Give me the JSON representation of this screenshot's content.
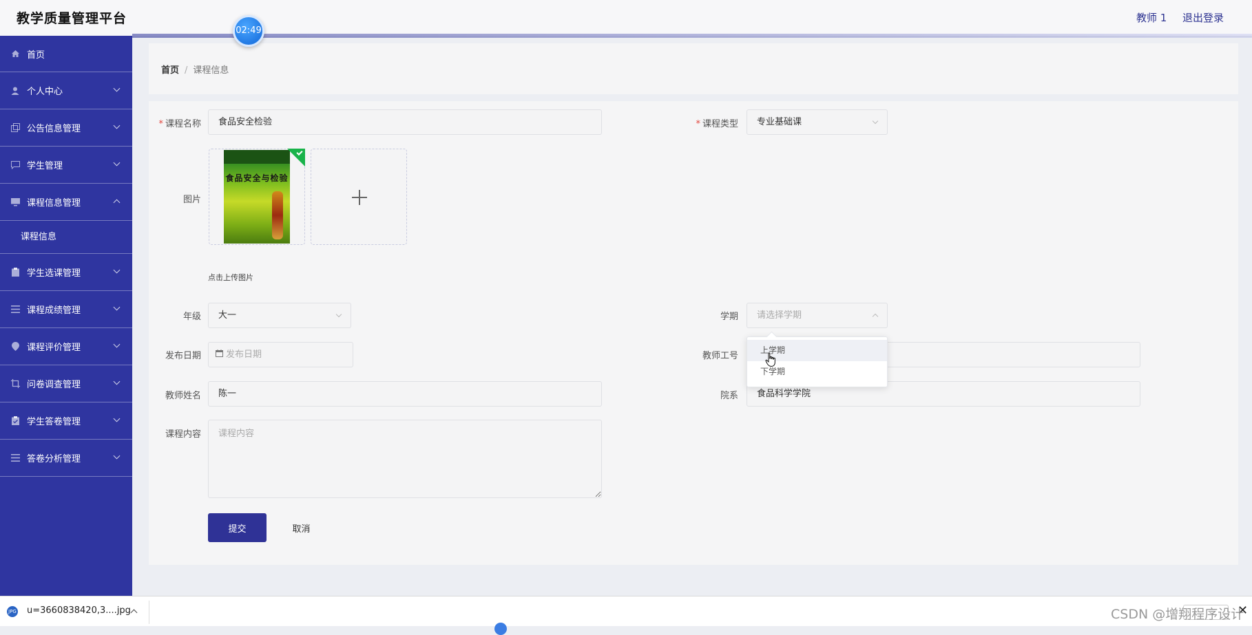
{
  "header": {
    "app_title": "教学质量管理平台",
    "timer": "02:49",
    "user": "教师 1",
    "logout": "退出登录"
  },
  "sidebar": {
    "items": [
      {
        "label": "首页",
        "icon": "home-icon"
      },
      {
        "label": "个人中心",
        "icon": "user-icon"
      },
      {
        "label": "公告信息管理",
        "icon": "copy-icon"
      },
      {
        "label": "学生管理",
        "icon": "chat-icon"
      },
      {
        "label": "课程信息管理",
        "icon": "monitor-icon",
        "expanded": true
      },
      {
        "label": "学生选课管理",
        "icon": "clipboard-icon"
      },
      {
        "label": "课程成绩管理",
        "icon": "list-icon"
      },
      {
        "label": "课程评价管理",
        "icon": "location-icon"
      },
      {
        "label": "问卷调查管理",
        "icon": "crop-icon"
      },
      {
        "label": "学生答卷管理",
        "icon": "clipboard-check-icon"
      },
      {
        "label": "答卷分析管理",
        "icon": "list-icon"
      }
    ],
    "subitem": "课程信息"
  },
  "breadcrumb": {
    "home": "首页",
    "separator": "/",
    "current": "课程信息"
  },
  "form": {
    "course_name": {
      "label": "课程名称",
      "value": "食品安全检验"
    },
    "course_type": {
      "label": "课程类型",
      "value": "专业基础课"
    },
    "image": {
      "label": "图片",
      "cover_title": "食品安全与检验",
      "hint": "点击上传图片"
    },
    "grade": {
      "label": "年级",
      "value": "大一"
    },
    "semester": {
      "label": "学期",
      "placeholder": "请选择学期",
      "options": [
        "上学期",
        "下学期"
      ]
    },
    "publish_date": {
      "label": "发布日期",
      "placeholder": "发布日期"
    },
    "teacher_id": {
      "label": "教师工号",
      "value": ""
    },
    "teacher_name": {
      "label": "教师姓名",
      "value": "陈一"
    },
    "department": {
      "label": "院系",
      "value": "食品科学学院"
    },
    "content": {
      "label": "课程内容",
      "placeholder": "课程内容"
    },
    "submit": "提交",
    "cancel": "取消"
  },
  "download_bar": {
    "file_name": "u=3660838420,3....jpg",
    "file_badge": "JPG",
    "close": "✕"
  },
  "watermark": "CSDN @增翔程序设计",
  "colors": {
    "sidebar": "#2f35a0",
    "primary_button": "#2f3296",
    "required": "#e2463d",
    "upload_check": "#19b34a"
  }
}
